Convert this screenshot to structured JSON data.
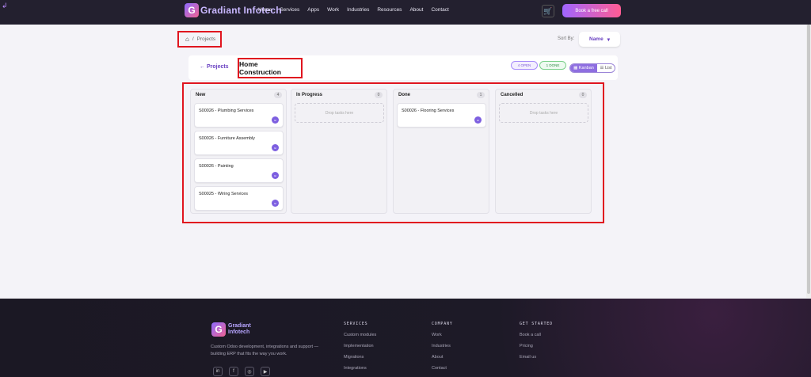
{
  "header": {
    "brand": "Gradiant Infotech",
    "nav": [
      "Home",
      "Services",
      "Apps",
      "Work",
      "Industries",
      "Resources",
      "About",
      "Contact"
    ],
    "cta": "Book a free call"
  },
  "breadcrumb": {
    "current": "Projects"
  },
  "sort": {
    "label": "Sort By:",
    "value": "Name"
  },
  "project": {
    "back": "Projects",
    "title": "Home Construction",
    "open_label": "OPEN",
    "open_count": "4",
    "done_label": "DONE",
    "done_count": "1",
    "view_kanban": "Kanban",
    "view_list": "List"
  },
  "columns": [
    {
      "title": "New",
      "count": "4",
      "cards": [
        "S00026 - Plumbing Services",
        "S00026 - Furniture Assembly",
        "S00026 - Painting",
        "S00025 - Wiring Services"
      ]
    },
    {
      "title": "In Progress",
      "count": "0",
      "cards": [],
      "empty": "Drop tasks here"
    },
    {
      "title": "Done",
      "count": "1",
      "cards": [
        "S00026 - Flooring Services"
      ]
    },
    {
      "title": "Cancelled",
      "count": "0",
      "cards": [],
      "empty": "Drop tasks here"
    }
  ],
  "footer": {
    "brand_line1": "Gradiant",
    "brand_line2": "Infotech",
    "desc": "Custom Odoo development, integrations and support — building ERP that fits the way you work.",
    "services": {
      "title": "SERVICES",
      "items": [
        "Custom modules",
        "Implementation",
        "Migrations",
        "Integrations"
      ]
    },
    "company": {
      "title": "COMPANY",
      "items": [
        "Work",
        "Industries",
        "About",
        "Contact"
      ]
    },
    "get_started": {
      "title": "GET STARTED",
      "items": [
        "Book a call",
        "Pricing",
        "Email us"
      ]
    }
  },
  "colors": {
    "accent": "#6a42c2",
    "highlight": "#e0151f",
    "header_bg": "#23202f"
  }
}
